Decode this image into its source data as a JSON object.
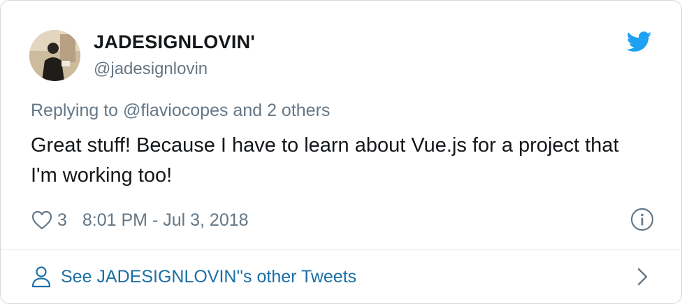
{
  "author": {
    "display_name": "JADESIGNLOVIN'",
    "handle": "@jadesignlovin",
    "avatar_icon": "user-avatar-photo"
  },
  "platform_icon": "twitter-bird-icon",
  "reply_context": "Replying to @flaviocopes and 2 others",
  "tweet": {
    "text": "Great stuff! Because I have to learn about Vue.js for a project that I'm working too!"
  },
  "meta": {
    "like_icon": "heart-icon",
    "like_count": "3",
    "timestamp": "8:01 PM - Jul 3, 2018",
    "info_icon": "info-icon"
  },
  "footer": {
    "icon": "person-icon",
    "label": "See JADESIGNLOVIN''s other Tweets",
    "chevron_icon": "chevron-right-icon"
  },
  "colors": {
    "twitter_blue": "#1da1f2",
    "link_blue": "#1b6fa6",
    "muted_gray": "#657786",
    "text_dark": "#14171a",
    "border": "#cfd9de"
  }
}
